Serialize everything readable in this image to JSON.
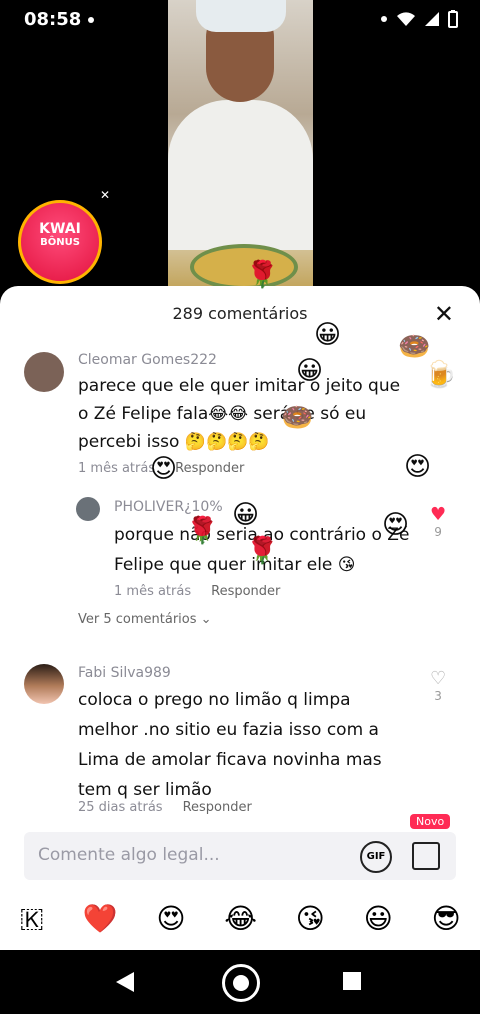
{
  "status_bar": {
    "time": "08:58"
  },
  "video": {
    "kwai_badge": [
      "KWAI",
      "BÔNUS"
    ]
  },
  "sheet": {
    "title": "289 comentários",
    "comments": [
      {
        "author": "Cleomar Gomes222",
        "lines": [
          "parece que ele quer imitar o jeito que",
          "o Zé Felipe fala😂😂 será se só eu",
          "percebi isso 🤔🤔🤔🤔"
        ],
        "time": "1 mês atrás",
        "reply_label": "Responder"
      },
      {
        "author": "PHOLIVER¿10%",
        "lines": [
          "porque não seria ao contrário o Zé",
          "Felipe que quer imitar ele 😘"
        ],
        "time": "1 mês atrás",
        "reply_label": "Responder",
        "likes": "9"
      },
      {
        "author": "Fabi Silva989",
        "lines": [
          "coloca o prego no limão q limpa",
          "melhor .no sitio eu fazia isso com a",
          "Lima de amolar ficava novinha mas",
          "tem q ser limão"
        ],
        "time": "25 dias atrás",
        "reply_label": "Responder",
        "likes": "3"
      }
    ],
    "more_replies": "Ver 5 comentários",
    "input_placeholder": "Comente algo legal...",
    "gif_label": "GIF",
    "new_badge": "Novo",
    "emoji_bar": [
      "🇰",
      "❤️",
      "😍",
      "😂",
      "😘",
      "😃",
      "😎"
    ]
  }
}
